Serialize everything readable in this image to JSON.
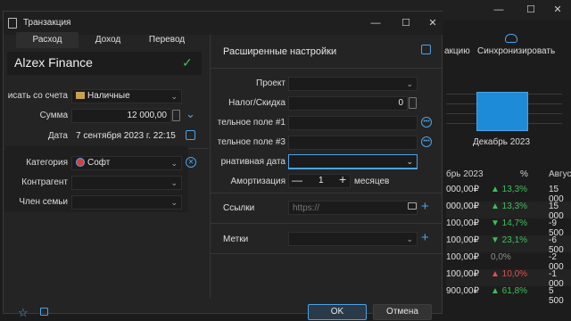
{
  "background_window": {
    "controls": {
      "minimize": "—",
      "maximize": "☐",
      "close": "✕"
    },
    "toolbar": {
      "left_label": "акцию",
      "sync_label": "Синхронизировать"
    },
    "chart_label": "Декабрь 2023",
    "table": {
      "headers": [
        "брь 2023",
        "%",
        "Авгус"
      ],
      "rows": [
        {
          "amount": "000,00₽",
          "pct": "▲ 13,3%",
          "trend": "up",
          "next": "15 000"
        },
        {
          "amount": "000,00₽",
          "pct": "▲ 13,3%",
          "trend": "up",
          "next": "15 000"
        },
        {
          "amount": "100,00₽",
          "pct": "▼ 14,7%",
          "trend": "up",
          "next": "-9 500"
        },
        {
          "amount": "100,00₽",
          "pct": "▼ 23,1%",
          "trend": "up",
          "next": "-6 500"
        },
        {
          "amount": "100,00₽",
          "pct": "0,0%",
          "trend": "flat",
          "next": "-2 000"
        },
        {
          "amount": "100,00₽",
          "pct": "▲ 10,0%",
          "trend": "down",
          "next": "-1 000"
        },
        {
          "amount": "900,00₽",
          "pct": "▲ 61,8%",
          "trend": "up",
          "next": "5 500"
        }
      ]
    }
  },
  "dialog": {
    "title": "Транзакция",
    "controls": {
      "minimize": "—",
      "maximize": "☐",
      "close": "✕"
    },
    "tabs": [
      {
        "label": "Расход",
        "active": true
      },
      {
        "label": "Доход",
        "active": false
      },
      {
        "label": "Перевод",
        "active": false
      }
    ],
    "name": "Alzex Finance",
    "check": "✓",
    "from_account": {
      "label": "исать со счета",
      "value": "Наличные"
    },
    "amount": {
      "label": "Сумма",
      "value": "12 000,00"
    },
    "date": {
      "label": "Дата",
      "value": "7 сентября 2023 г. 22:15"
    },
    "category": {
      "label": "Категория",
      "value": "Софт"
    },
    "counterparty": {
      "label": "Контрагент",
      "value": ""
    },
    "family_member": {
      "label": "Член семьи",
      "value": ""
    },
    "advanced": {
      "title": "Расширенные настройки",
      "project": {
        "label": "Проект",
        "value": ""
      },
      "tax": {
        "label": "Налог/Скидка",
        "value": "0"
      },
      "field1": {
        "label": "тельное поле #1",
        "value": ""
      },
      "field3": {
        "label": "тельное поле #3",
        "value": ""
      },
      "alt_date": {
        "label": "рнативная дата",
        "value": ""
      },
      "amortization": {
        "label": "Амортизация",
        "value": "1",
        "unit": "месяцев"
      },
      "links": {
        "label": "Ссылки",
        "placeholder": "https://"
      },
      "tags": {
        "label": "Метки",
        "value": ""
      }
    },
    "ok_label": "OK",
    "cancel_label": "Отмена"
  },
  "colors": {
    "accent": "#4aa3e8",
    "check": "#3cc05a",
    "up": "#3cc05a",
    "down": "#e05050"
  }
}
